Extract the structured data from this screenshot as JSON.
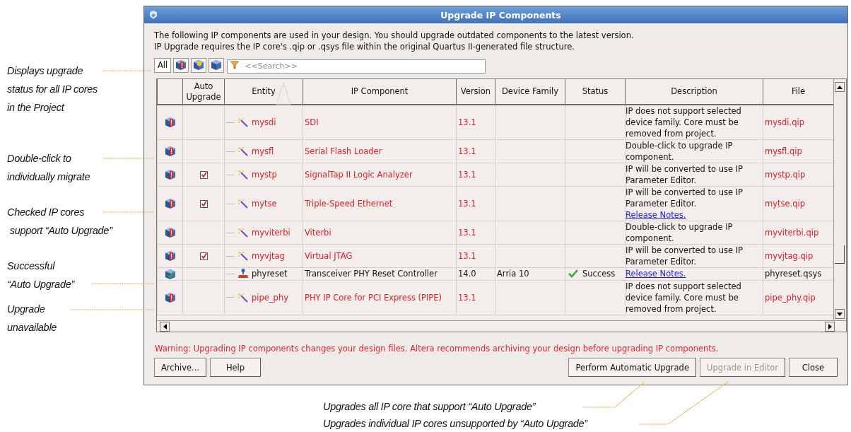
{
  "window": {
    "title": "Upgrade IP Components"
  },
  "intro": [
    "The following IP components are used in your design. You should upgrade outdated components to the latest version.",
    "IP Upgrade requires the IP core's .qip or .qsys file within the original Quartus II-generated file structure."
  ],
  "filter_buttons": [
    {
      "kind": "text",
      "label": "All"
    },
    {
      "kind": "outdated"
    },
    {
      "kind": "new"
    },
    {
      "kind": "current"
    }
  ],
  "search": {
    "placeholder": "<<Search>>"
  },
  "table": {
    "columns": [
      "Auto Upgrade",
      "Entity",
      "IP Component",
      "Version",
      "Device Family",
      "Status",
      "Description",
      "File"
    ],
    "rows": [
      {
        "kind": "outdated",
        "auto_upgrade": false,
        "entity": "mysdi",
        "ip_component": "SDI",
        "version": "13.1",
        "description": "IP does not support selected device family. Core must be removed from project.",
        "file": "mysdi.qip"
      },
      {
        "kind": "outdated",
        "auto_upgrade": false,
        "entity": "mysfl",
        "ip_component": "Serial Flash Loader",
        "version": "13.1",
        "description": "Double-click to upgrade IP component.",
        "file": "mysfl.qip"
      },
      {
        "kind": "outdated",
        "auto_upgrade": true,
        "entity": "mystp",
        "ip_component": "SignalTap II Logic Analyzer",
        "version": "13.1",
        "description": "IP will be converted to use IP Parameter Editor.",
        "file": "mystp.qip"
      },
      {
        "kind": "outdated",
        "auto_upgrade": true,
        "entity": "mytse",
        "ip_component": "Triple-Speed Ethernet",
        "version": "13.1",
        "description": "IP will be converted to use IP Parameter Editor.",
        "link": "Release Notes.",
        "file": "mytse.qip"
      },
      {
        "kind": "outdated",
        "auto_upgrade": false,
        "entity": "myviterbi",
        "ip_component": "Viterbi",
        "version": "13.1",
        "description": "Double-click to upgrade IP component.",
        "file": "myviterbi.qip"
      },
      {
        "kind": "outdated",
        "auto_upgrade": true,
        "entity": "myvjtag",
        "ip_component": "Virtual JTAG",
        "version": "13.1",
        "description": "IP will be converted to use IP Parameter Editor.",
        "file": "myvjtag.qip"
      },
      {
        "kind": "success",
        "auto_upgrade": false,
        "entity": "phyreset",
        "ip_component": "Transceiver PHY Reset Controller",
        "version": "14.0",
        "device_family": "Arria 10",
        "status": "Success",
        "link": "Release Notes.",
        "file": "phyreset.qsys"
      },
      {
        "kind": "outdated",
        "auto_upgrade": false,
        "entity": "pipe_phy",
        "ip_component": "PHY IP Core for PCI Express (PIPE)",
        "version": "13.1",
        "description": "IP does not support selected device family. Core must be removed from project.",
        "file": "pipe_phy.qip"
      }
    ]
  },
  "warning": "Warning: Upgrading IP components changes your design files. Altera recommends archiving your design before upgrading IP components.",
  "buttons": [
    {
      "label": "Archive...",
      "disabled": false
    },
    {
      "label": "Help",
      "disabled": false
    },
    {
      "label": "Perform Automatic Upgrade",
      "disabled": false
    },
    {
      "label": "Upgrade in Editor",
      "disabled": true
    },
    {
      "label": "Close",
      "disabled": false
    }
  ],
  "callouts": [
    {
      "lines": [
        "Displays upgrade",
        "status for all IP cores",
        "in the Project"
      ]
    },
    {
      "lines": [
        "Double-click to",
        "individually migrate"
      ]
    },
    {
      "lines": [
        "Checked IP cores",
        " support “Auto Upgrade”"
      ]
    },
    {
      "lines": [
        "Successful",
        "“Auto Upgrade”"
      ]
    },
    {
      "lines": [
        "Upgrade",
        "unavailable"
      ]
    }
  ],
  "bottom_callouts": [
    "Upgrades all IP core that support “Auto Upgrade”",
    "Upgrades individual IP cores unsupported by “Auto Upgrade”"
  ]
}
